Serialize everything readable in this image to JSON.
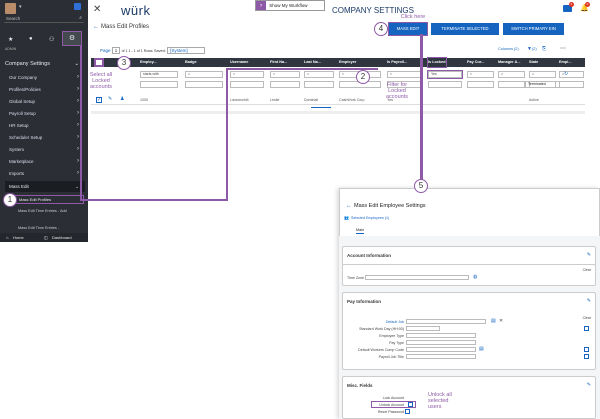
{
  "sidebar": {
    "search_placeholder": "Search",
    "admin_label": "ADMIN",
    "section_title": "Company Settings",
    "items": [
      {
        "label": "Our Company"
      },
      {
        "label": "Profiles/Policies"
      },
      {
        "label": "Global Setup"
      },
      {
        "label": "Payroll Setup"
      },
      {
        "label": "HR Setup"
      },
      {
        "label": "Scheduler Setup"
      },
      {
        "label": "System"
      },
      {
        "label": "Marketplace"
      },
      {
        "label": "Imports"
      },
      {
        "label": "Mass Edit"
      }
    ],
    "sub_items": [
      {
        "label": "Mass Edit Profiles"
      },
      {
        "label": "Mass Edit Time Entries - Add"
      },
      {
        "label": "Mass Edit Time Entries -"
      }
    ],
    "home_label": "Home",
    "dashboard_label": "Dashboard"
  },
  "header": {
    "logo": "würk",
    "breadcrumb": "Mass Edit Profiles",
    "tooltip": "Show My Wurkflow",
    "company_settings": "COMPANY SETTINGS",
    "notif_count": "4",
    "alert_count": "0"
  },
  "toolbar": {
    "page_label": "Page",
    "page_value": "1",
    "page_info": "of 1 1 - 1 of 1 Rows",
    "saved_label": "Saved:",
    "saved_value": "[System]",
    "mass_edit": "MASS EDIT",
    "terminate": "TERMINATE SELECTED EMPLOYEES",
    "switch_primary": "SWITCH PRIMARY EIN",
    "columns": "Columns (2)",
    "filter_count": "(2)"
  },
  "table": {
    "headers": [
      "Employ...",
      "Badge",
      "Username",
      "First Na...",
      "Last Na...",
      "Employer",
      "Is Payroll...",
      "Is Locked",
      "Pay Cur...",
      "Manager A...",
      "State",
      "Empl..."
    ],
    "filters": [
      "starts with",
      "=",
      "=",
      "=",
      "=",
      "=",
      "=",
      "Yes",
      "=",
      "=",
      "=",
      "="
    ],
    "row": {
      "employee_id": "1000",
      "username": "Ldoeworld4",
      "first_name": "Leslie",
      "last_name": "Dominati",
      "employer": "CashWork Corp",
      "is_payroll": "Yes",
      "status": "Active"
    },
    "status_filter": "Terminated"
  },
  "callouts": {
    "c1": "1",
    "c2": "2",
    "c3": "3",
    "c4": "4",
    "c5": "5",
    "click_here": "Click here",
    "select_all": "Select all Locked accounts",
    "filter_for": "Filter for Locked accounts",
    "unlock_all": "Unlock all selected users"
  },
  "dialog": {
    "title": "Mass Edit Employee Settings",
    "selected": "Selected Employees (1)",
    "tab_main": "Main",
    "account_info": "Account Information",
    "clear": "Clear",
    "time_zone": "Time Zone",
    "pay_info": "Pay Information",
    "default_job": "Default Job",
    "std_work_day": "Standard Work Day (HH:00)",
    "employee_type": "Employee Type",
    "pay_type": "Pay Type",
    "default_workers_comp": "Default Workers Comp Code",
    "payroll_job_title": "Payroll Job Title",
    "misc_fields": "Misc. Fields",
    "lock_account": "Lock Account",
    "unlock_account": "Unlock Account",
    "reset_password": "Reset Password"
  },
  "colors": {
    "sidebar": "#2b2f35",
    "blue": "#1565c0",
    "table_header": "#2f3640",
    "purple": "#8e5aa8",
    "highlight": "#1a1d21"
  }
}
